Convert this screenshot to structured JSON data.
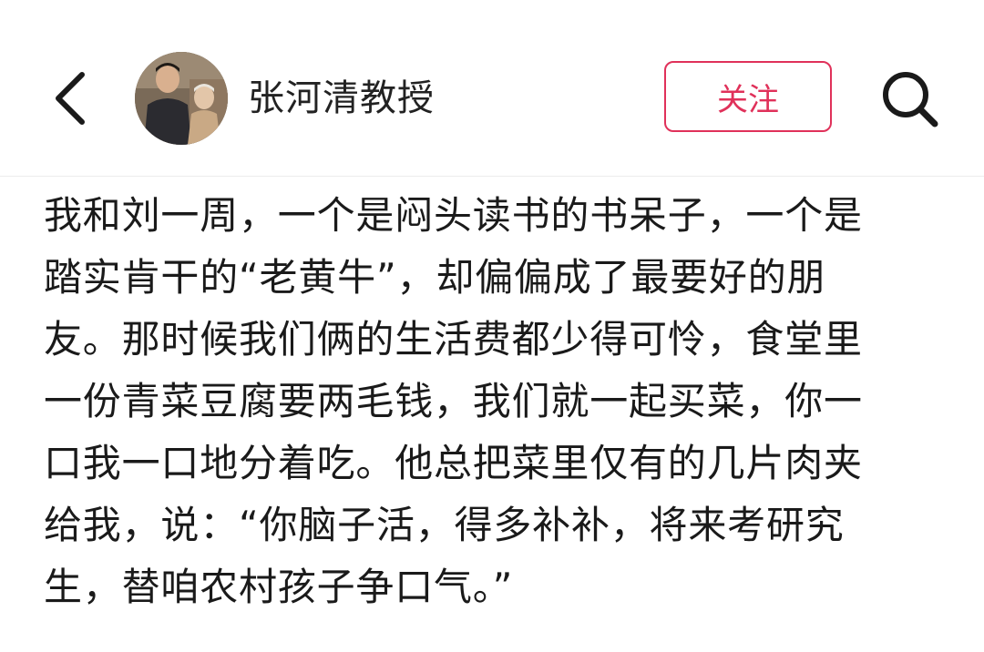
{
  "header": {
    "back_icon": "chevron-left-icon",
    "author_name": "张河清教授",
    "follow_label": "关注",
    "search_icon": "search-icon",
    "accent_color": "#e0315a"
  },
  "post": {
    "lines": [
      "我和刘一周，一个是闷头读书的书呆子，一个是",
      "踏实肯干的“老黄牛”，却偏偏成了最要好的朋",
      "友。那时候我们俩的生活费都少得可怜，食堂里",
      "一份青菜豆腐要两毛钱，我们就一起买菜，你一",
      "口我一口地分着吃。他总把菜里仅有的几片肉夹",
      "给我，说：“你脑子活，得多补补，将来考研究",
      "生，替咱农村孩子争口气。”"
    ]
  }
}
